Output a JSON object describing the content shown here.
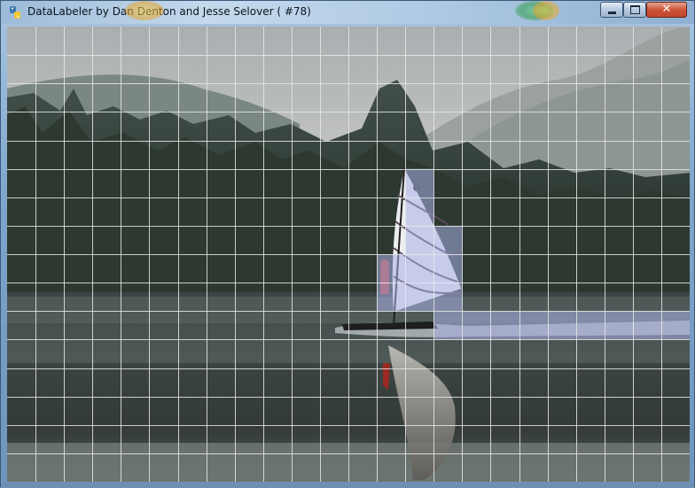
{
  "window": {
    "title": "DataLabeler by Dan Denton and Jesse Selover ( #78)",
    "icon": "python-icon",
    "controls": {
      "minimize": "minimize-icon",
      "maximize": "maximize-icon",
      "close": "close-icon"
    }
  },
  "canvas": {
    "image_subject": "windsurfer-on-lake",
    "grid": {
      "columns": 24,
      "rows": 16
    },
    "grid_color": "#e8e8e8",
    "selection_color": "#aab0e6",
    "selected_cells": [
      [
        14,
        5
      ],
      [
        14,
        6
      ],
      [
        14,
        7
      ],
      [
        15,
        7
      ],
      [
        13,
        8
      ],
      [
        14,
        8
      ],
      [
        15,
        8
      ],
      [
        13,
        9
      ],
      [
        14,
        9
      ],
      [
        15,
        9
      ],
      [
        15,
        10
      ],
      [
        16,
        10
      ],
      [
        17,
        10
      ],
      [
        18,
        10
      ],
      [
        19,
        10
      ],
      [
        20,
        10
      ],
      [
        21,
        10
      ],
      [
        22,
        10
      ],
      [
        23,
        10
      ]
    ]
  },
  "colors": {
    "titlebar": "#b0cbe4",
    "close_button": "#cc5438",
    "frame": "#7ea6cc"
  }
}
